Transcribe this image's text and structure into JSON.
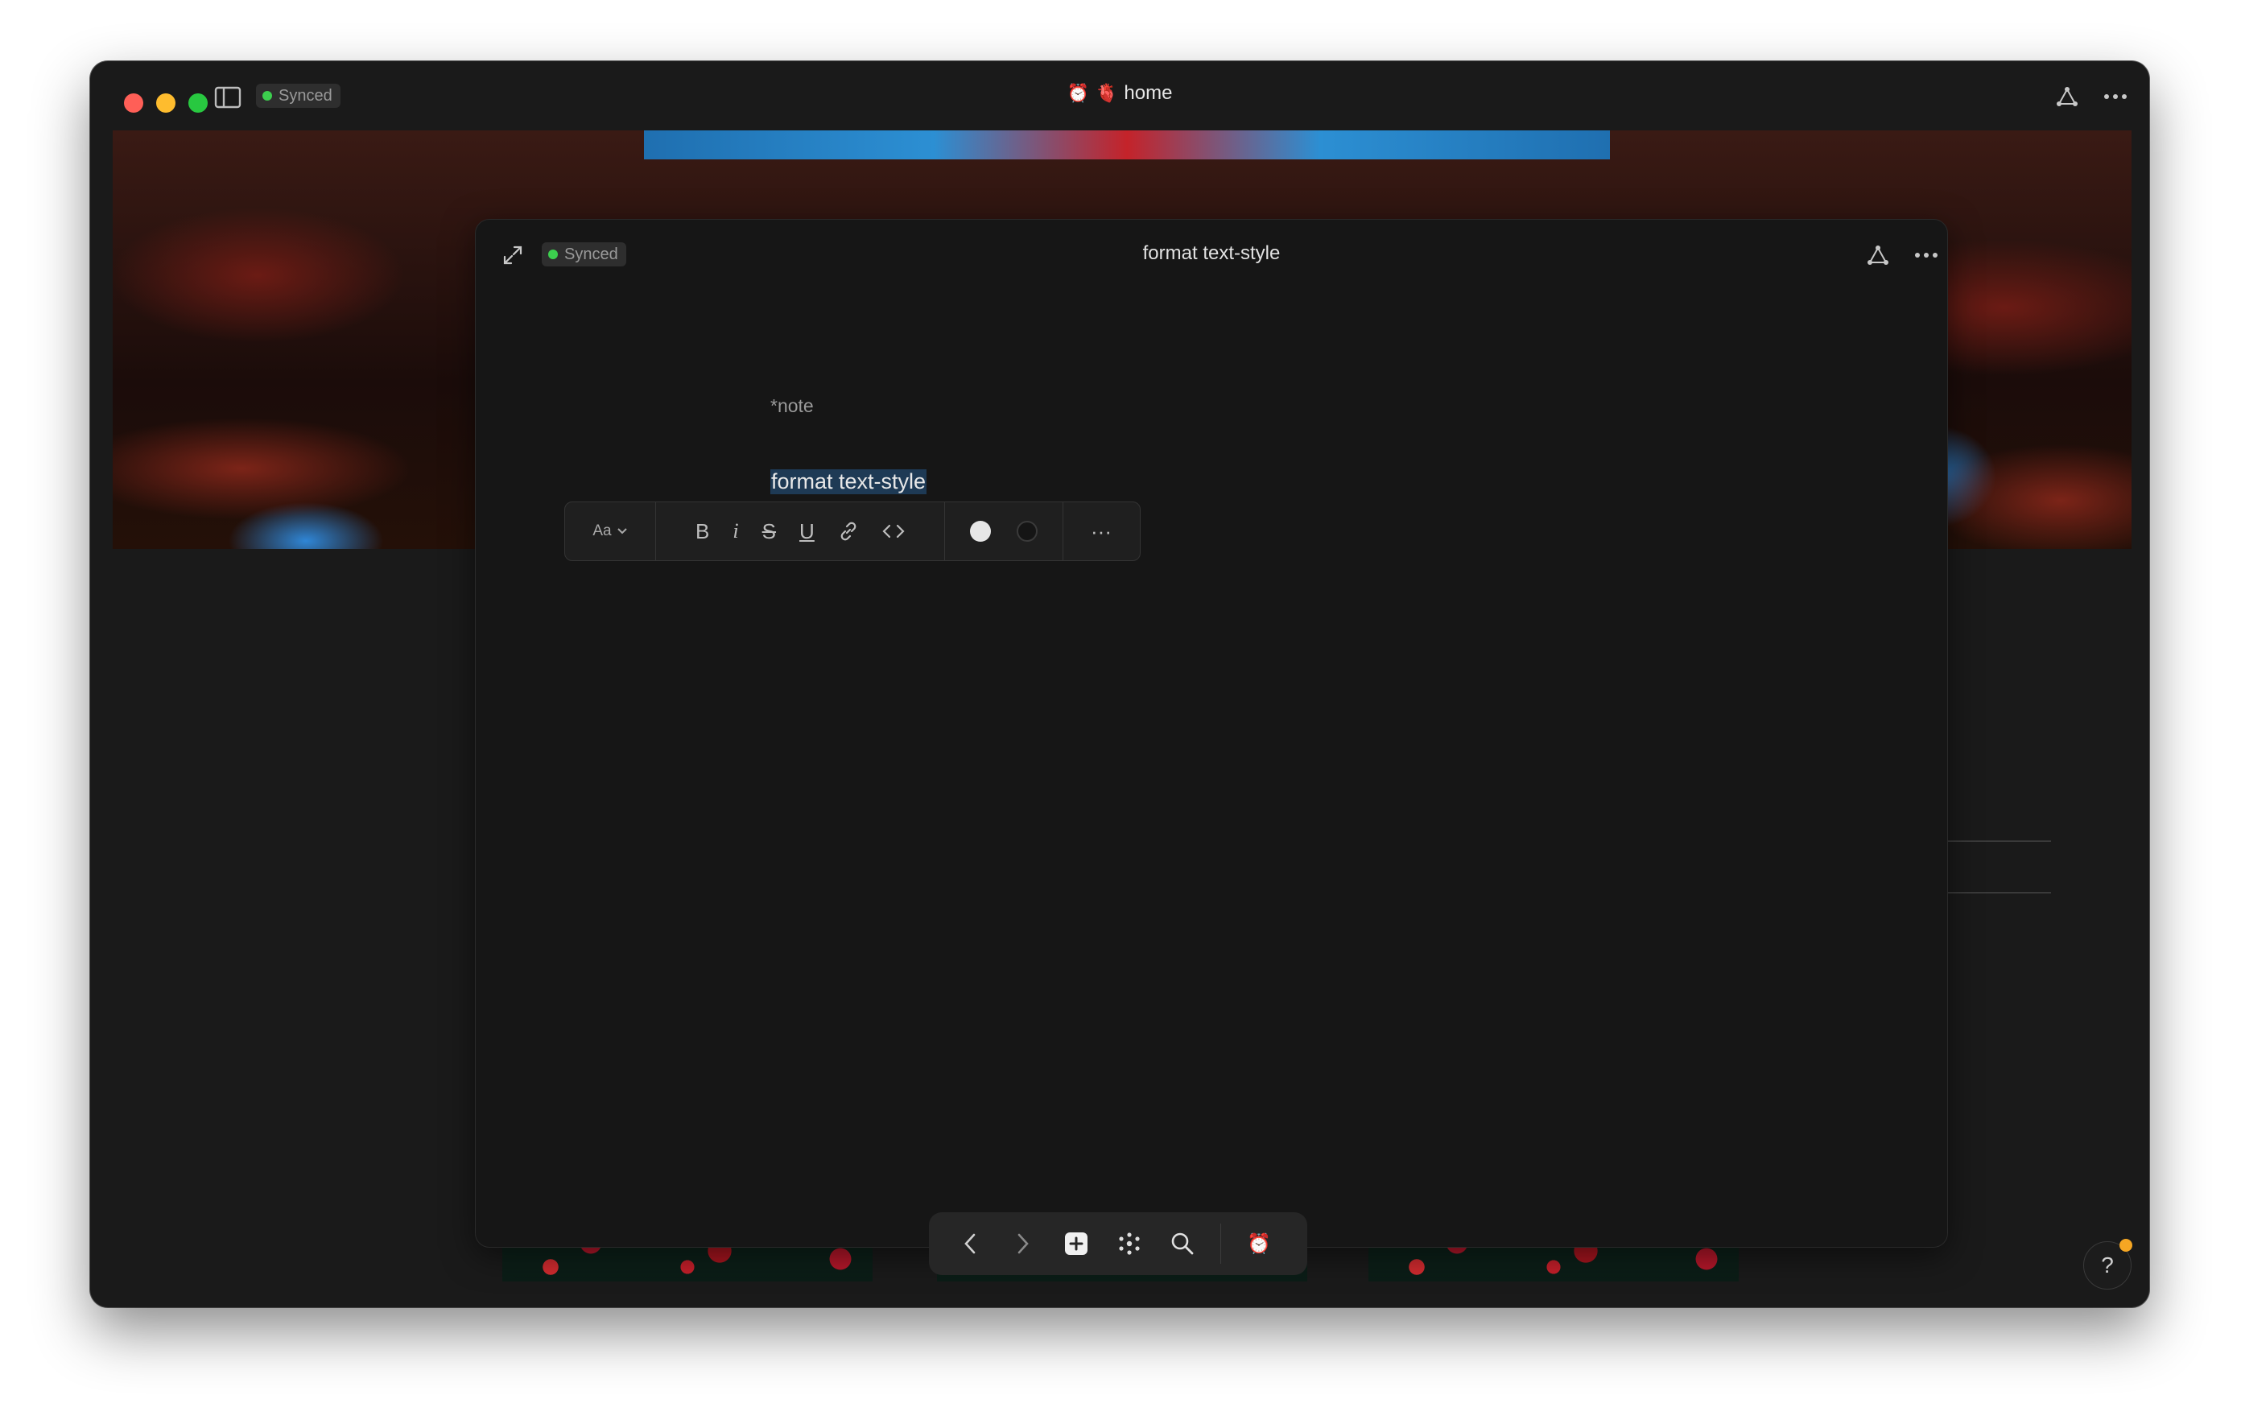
{
  "window": {
    "synced_label": "Synced",
    "title_icons": [
      "⏰",
      "🫀"
    ],
    "title": "home"
  },
  "panel": {
    "synced_label": "Synced",
    "title": "format text-style",
    "note_label": "*note",
    "selected_text": "format text-style"
  },
  "toolbar": {
    "text_style_label": "Aa",
    "bold_glyph": "B",
    "italic_glyph": "i",
    "strike_glyph": "S",
    "underline_glyph": "U",
    "more_glyph": "···"
  },
  "background_doc": {
    "emoji": "🧵"
  },
  "dock": {
    "app_emoji": "⏰"
  },
  "help": {
    "label": "?"
  },
  "colors": {
    "window_bg": "#1a1a1a",
    "panel_bg": "#161616",
    "selection": "#1e3a55",
    "synced_dot": "#3ccf4e",
    "notification_dot": "#f5a623"
  },
  "icons": [
    "sidebar-toggle-icon",
    "share-graph-icon",
    "more-options-icon",
    "expand-icon",
    "link-icon",
    "code-icon",
    "chevron-left-icon",
    "chevron-right-icon",
    "add-icon",
    "graph-icon",
    "search-icon",
    "chevron-down-icon"
  ]
}
